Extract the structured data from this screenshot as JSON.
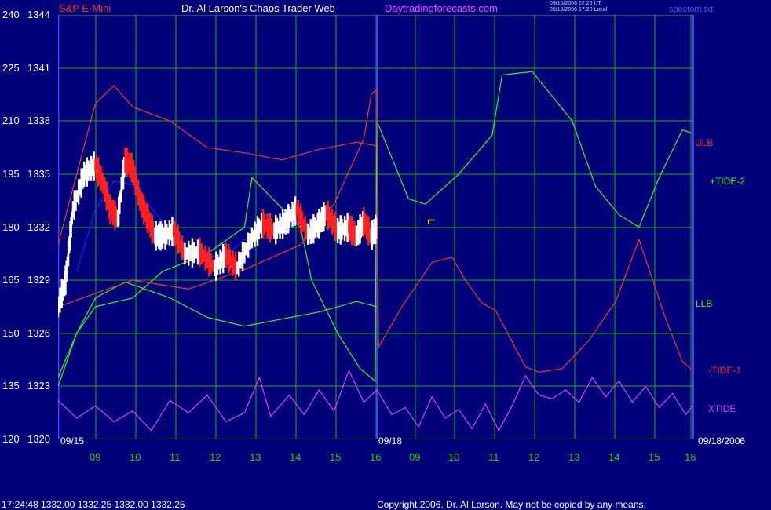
{
  "header": {
    "instrument": "S&P E-Mini",
    "title": "Dr. Al Larson's Chaos Trader Web",
    "site": "Daytradingforecasts.com",
    "stamp_line1": "09/15/2006 22:20 UT",
    "stamp_line2": "09/15/2006 17:20 Local",
    "file": "spectom.txt"
  },
  "footer": {
    "quote": "17:24:48   1332.00 1332.25 1332.00 1332.25",
    "copyright": "Copyright 2006, Dr. Al Larson. May not be copied by any means."
  },
  "colors": {
    "background": "#00007a",
    "grid": "#00c000",
    "price_up": "#ffffff",
    "price_down": "#ff2020",
    "ulb": "#ff3030",
    "llb": "#20ff20",
    "tide_plus": "#20ff20",
    "tide_minus": "#ff3030",
    "xtide": "#e040e0",
    "avg": "#2020ff",
    "vline": "#4040ff"
  },
  "chart_data": {
    "type": "line",
    "title": "S&P E-Mini",
    "y_left_outer": [
      "240",
      "225",
      "210",
      "195",
      "180",
      "165",
      "150",
      "135",
      "120"
    ],
    "y_left_inner": [
      "1344",
      "1341",
      "1338",
      "1335",
      "1332",
      "1329",
      "1326",
      "1323",
      "1320"
    ],
    "ylim_price": [
      1320,
      1344
    ],
    "ylim_index": [
      120,
      240
    ],
    "x_ticks": [
      "09",
      "10",
      "11",
      "12",
      "13",
      "14",
      "15",
      "16",
      "09",
      "10",
      "11",
      "12",
      "13",
      "14",
      "15",
      "16"
    ],
    "date_labels": {
      "start": "09/15",
      "mid": "09/18",
      "end": "09/18/2006"
    },
    "right_labels": [
      "ULB",
      "+TIDE-2",
      "LLB",
      "-TIDE-1",
      "XTIDE"
    ],
    "series": [
      {
        "name": "ULB",
        "points": [
          [
            0,
            1331
          ],
          [
            1,
            1339
          ],
          [
            1.5,
            1340
          ],
          [
            2,
            1338.8
          ],
          [
            3,
            1338
          ],
          [
            4,
            1336.5
          ],
          [
            5,
            1336.2
          ],
          [
            6,
            1335.8
          ],
          [
            7,
            1336.4
          ],
          [
            8,
            1336.8
          ],
          [
            8.55,
            1336.6
          ]
        ]
      },
      {
        "name": "LLB",
        "points": [
          [
            0,
            1323.5
          ],
          [
            0.5,
            1326
          ],
          [
            1,
            1328
          ],
          [
            1.8,
            1328.9
          ],
          [
            3,
            1328
          ],
          [
            4,
            1326.9
          ],
          [
            5,
            1326.4
          ],
          [
            6,
            1326.8
          ],
          [
            7,
            1327.2
          ],
          [
            8,
            1327.8
          ],
          [
            8.55,
            1327.5
          ]
        ]
      },
      {
        "name": "+TIDE-2",
        "points": [
          [
            0,
            1323
          ],
          [
            0.5,
            1326
          ],
          [
            1,
            1327.5
          ],
          [
            2,
            1328
          ],
          [
            2.8,
            1329.5
          ],
          [
            4,
            1330.5
          ],
          [
            5,
            1332
          ],
          [
            5.2,
            1334.8
          ],
          [
            6.5,
            1332
          ],
          [
            6.8,
            1329
          ],
          [
            7.5,
            1326
          ],
          [
            8.1,
            1324
          ],
          [
            8.5,
            1323.3
          ],
          [
            8.55,
            1338
          ],
          [
            9.5,
            1333.6
          ],
          [
            10,
            1333.3
          ],
          [
            11,
            1335
          ],
          [
            12,
            1337.2
          ],
          [
            12.3,
            1340.6
          ],
          [
            13.2,
            1340.8
          ],
          [
            14.4,
            1338
          ],
          [
            15.1,
            1334.3
          ],
          [
            15.8,
            1332.7
          ],
          [
            16.4,
            1332
          ],
          [
            17,
            1334.8
          ],
          [
            17.7,
            1337.5
          ],
          [
            18.0,
            1337.3
          ]
        ]
      },
      {
        "name": "-TIDE-1",
        "points": [
          [
            0,
            1327.5
          ],
          [
            2,
            1329
          ],
          [
            3.5,
            1328.5
          ],
          [
            5,
            1329.6
          ],
          [
            6.5,
            1331
          ],
          [
            7.4,
            1333.3
          ],
          [
            8.2,
            1337
          ],
          [
            8.4,
            1339.5
          ],
          [
            8.55,
            1339.8
          ],
          [
            8.6,
            1325.2
          ],
          [
            9.3,
            1327.5
          ],
          [
            10.2,
            1330
          ],
          [
            10.8,
            1330.3
          ],
          [
            11.2,
            1329
          ],
          [
            11.7,
            1327.7
          ],
          [
            12.1,
            1327.3
          ],
          [
            13,
            1324.1
          ],
          [
            13.4,
            1323.8
          ],
          [
            14.1,
            1324
          ],
          [
            14.9,
            1325.6
          ],
          [
            15.7,
            1327.8
          ],
          [
            16.4,
            1331.3
          ],
          [
            17.2,
            1326.8
          ],
          [
            17.7,
            1324.4
          ],
          [
            18.0,
            1323.9
          ]
        ]
      },
      {
        "name": "XTIDE",
        "points": [
          [
            0,
            1322.2
          ],
          [
            0.5,
            1321.2
          ],
          [
            1,
            1321.9
          ],
          [
            1.5,
            1321
          ],
          [
            2,
            1321.6
          ],
          [
            2.5,
            1320.5
          ],
          [
            3,
            1322.2
          ],
          [
            3.5,
            1321.5
          ],
          [
            4,
            1322.5
          ],
          [
            4.5,
            1321
          ],
          [
            5,
            1321.5
          ],
          [
            5.4,
            1323.5
          ],
          [
            5.7,
            1321.3
          ],
          [
            6.2,
            1322.5
          ],
          [
            6.6,
            1321.4
          ],
          [
            7,
            1322.8
          ],
          [
            7.4,
            1321.6
          ],
          [
            7.8,
            1323.9
          ],
          [
            8.2,
            1322.1
          ],
          [
            8.55,
            1322.8
          ],
          [
            9,
            1321.4
          ],
          [
            9.4,
            1321.8
          ],
          [
            9.8,
            1320.7
          ],
          [
            10.2,
            1322.4
          ],
          [
            10.6,
            1321.2
          ],
          [
            11,
            1321.7
          ],
          [
            11.4,
            1320.6
          ],
          [
            11.8,
            1322
          ],
          [
            12.2,
            1320.5
          ],
          [
            12.6,
            1321.9
          ],
          [
            13,
            1323.6
          ],
          [
            13.4,
            1322.5
          ],
          [
            13.8,
            1322.3
          ],
          [
            14.2,
            1322.8
          ],
          [
            14.6,
            1322.1
          ],
          [
            15,
            1323.5
          ],
          [
            15.4,
            1322.4
          ],
          [
            15.8,
            1323.3
          ],
          [
            16.2,
            1322.1
          ],
          [
            16.6,
            1323
          ],
          [
            17,
            1321.8
          ],
          [
            17.4,
            1322.6
          ],
          [
            17.8,
            1321.4
          ],
          [
            18.0,
            1321.9
          ]
        ]
      },
      {
        "name": "Price",
        "points": [
          [
            0,
            1327.5
          ],
          [
            0.2,
            1329
          ],
          [
            0.4,
            1333
          ],
          [
            0.7,
            1335
          ],
          [
            1,
            1335.5
          ],
          [
            1.2,
            1334.5
          ],
          [
            1.4,
            1333
          ],
          [
            1.6,
            1332.5
          ],
          [
            1.8,
            1335.8
          ],
          [
            2,
            1335.3
          ],
          [
            2.2,
            1333.5
          ],
          [
            2.4,
            1332.5
          ],
          [
            2.6,
            1331.5
          ],
          [
            2.8,
            1331.5
          ],
          [
            3.1,
            1331.8
          ],
          [
            3.4,
            1330.5
          ],
          [
            3.8,
            1330.6
          ],
          [
            4.2,
            1329.7
          ],
          [
            4.5,
            1330.4
          ],
          [
            4.8,
            1329.7
          ],
          [
            5.2,
            1331.4
          ],
          [
            5.5,
            1332.2
          ],
          [
            5.8,
            1331.8
          ],
          [
            6.1,
            1332.3
          ],
          [
            6.4,
            1333
          ],
          [
            6.7,
            1331.6
          ],
          [
            7,
            1332.2
          ],
          [
            7.2,
            1332.8
          ],
          [
            7.5,
            1331.8
          ],
          [
            7.8,
            1332
          ],
          [
            8,
            1331.5
          ],
          [
            8.2,
            1332.3
          ],
          [
            8.4,
            1331.5
          ],
          [
            8.55,
            1332
          ]
        ]
      },
      {
        "name": "Average",
        "points": [
          [
            0.5,
            1329.5
          ],
          [
            1,
            1333
          ],
          [
            1.5,
            1334.6
          ],
          [
            2,
            1334.4
          ],
          [
            2.6,
            1332.8
          ],
          [
            3.2,
            1331.4
          ],
          [
            3.8,
            1330.6
          ],
          [
            4.4,
            1330.2
          ],
          [
            5,
            1331.3
          ],
          [
            5.6,
            1331.9
          ],
          [
            6.2,
            1332.2
          ],
          [
            6.8,
            1332.3
          ],
          [
            7.4,
            1332.1
          ],
          [
            8,
            1331.9
          ],
          [
            8.55,
            1332
          ]
        ]
      }
    ]
  }
}
